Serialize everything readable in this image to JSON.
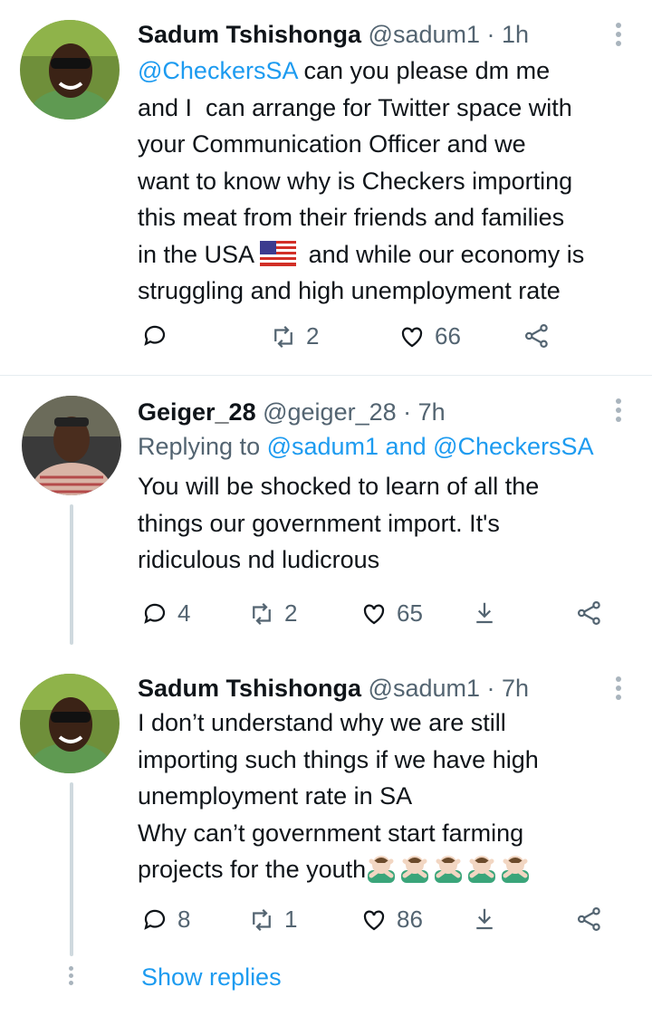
{
  "tweets": [
    {
      "name": "Sadum Tshishonga",
      "handle": "@sadum1",
      "time": "1h",
      "text_mention": "@CheckersSA",
      "text_part1": " can you please dm me\nand I  can arrange for Twitter space with\nyour Communication Officer and we\nwant to know why is Checkers importing\nthis meat from their friends and families\nin the USA",
      "text_part2": " and while our economy is\nstruggling and high unemployment rate",
      "retweets": "2",
      "likes": "66"
    },
    {
      "name": "Geiger_28",
      "handle": "@geiger_28",
      "time": "7h",
      "replying_prefix": "Replying to ",
      "replying_users": "@sadum1 and @CheckersSA",
      "text": "You will be shocked to learn of all the\nthings our government import. It's\nridiculous nd ludicrous",
      "replies": "4",
      "retweets": "2",
      "likes": "65"
    },
    {
      "name": "Sadum Tshishonga",
      "handle": "@sadum1",
      "time": "7h",
      "text": "I don’t understand why we are still\nimporting such things if we have high\nunemployment rate in SA\nWhy can’t government start farming\nprojects for the youth",
      "emoji_count": 5,
      "replies": "8",
      "retweets": "1",
      "likes": "86"
    }
  ],
  "dot": " · ",
  "show_replies": "Show replies",
  "colors": {
    "accent": "#1d9bf0",
    "muted": "#536471",
    "thread_line": "#cfd9de"
  },
  "icons": [
    "reply-icon",
    "retweet-icon",
    "like-icon",
    "share-icon",
    "download-icon",
    "more-icon",
    "us-flag-icon",
    "man-gesturing-no-icon"
  ]
}
